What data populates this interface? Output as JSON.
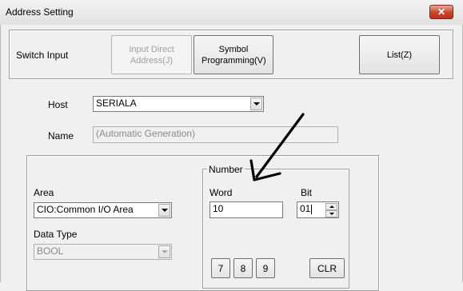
{
  "window": {
    "title": "Address Setting",
    "close_glyph": "✕"
  },
  "toolbar": {
    "switch_input_label": "Switch Input",
    "input_direct_address": "Input Direct Address(J)",
    "symbol_programming": "Symbol Programming(V)",
    "list": "List(Z)"
  },
  "host": {
    "label": "Host",
    "value": "SERIALA"
  },
  "name": {
    "label": "Name",
    "value": "(Automatic Generation)"
  },
  "area": {
    "label": "Area",
    "value": "CIO:Common I/O Area"
  },
  "data_type": {
    "label": "Data Type",
    "value": "BOOL"
  },
  "number": {
    "group_label": "Number",
    "word_label": "Word",
    "word_value": "10",
    "bit_label": "Bit",
    "bit_value": "01"
  },
  "keypad": {
    "keys": [
      "7",
      "8",
      "9"
    ],
    "clear": "CLR"
  },
  "annotation": {
    "type": "arrow-icon",
    "color": "#000000"
  }
}
